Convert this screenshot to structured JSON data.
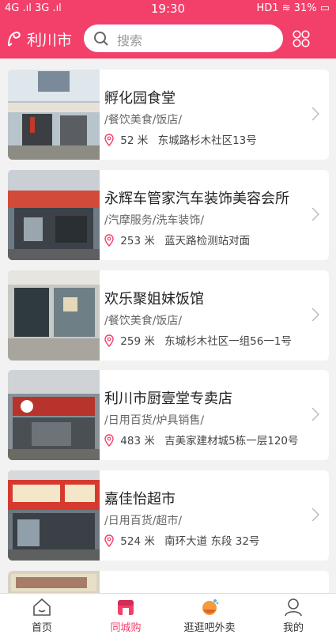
{
  "status": {
    "left": "4G .ıl 3G .ıl",
    "time": "19:30",
    "right": "HD1 ≋ 31% ▭"
  },
  "header": {
    "city": "利川市",
    "search_placeholder": "搜索"
  },
  "listings": [
    {
      "title": "孵化园食堂",
      "category": "/餐饮美食/饭店/",
      "distance": "52 米",
      "address": "东城路杉木社区13号"
    },
    {
      "title": "永辉车管家汽车装饰美容会所",
      "category": "/汽摩服务/洗车装饰/",
      "distance": "253 米",
      "address": "蓝天路检测站对面"
    },
    {
      "title": "欢乐聚姐妹饭馆",
      "category": "/餐饮美食/饭店/",
      "distance": "259 米",
      "address": "东城杉木社区一组56一1号"
    },
    {
      "title": "利川市厨壹堂专卖店",
      "category": "/日用百货/炉具销售/",
      "distance": "483 米",
      "address": "吉美家建材城5栋一层120号"
    },
    {
      "title": "嘉佳怡超市",
      "category": "/日用百货/超市/",
      "distance": "524 米",
      "address": "南环大道 东段 32号"
    }
  ],
  "tabs": [
    {
      "label": "首页",
      "icon": "home-icon"
    },
    {
      "label": "同城购",
      "icon": "shop-icon"
    },
    {
      "label": "逛逛吧外卖",
      "icon": "takeout-icon"
    },
    {
      "label": "我的",
      "icon": "user-icon"
    }
  ],
  "colors": {
    "accent": "#f2406a"
  }
}
